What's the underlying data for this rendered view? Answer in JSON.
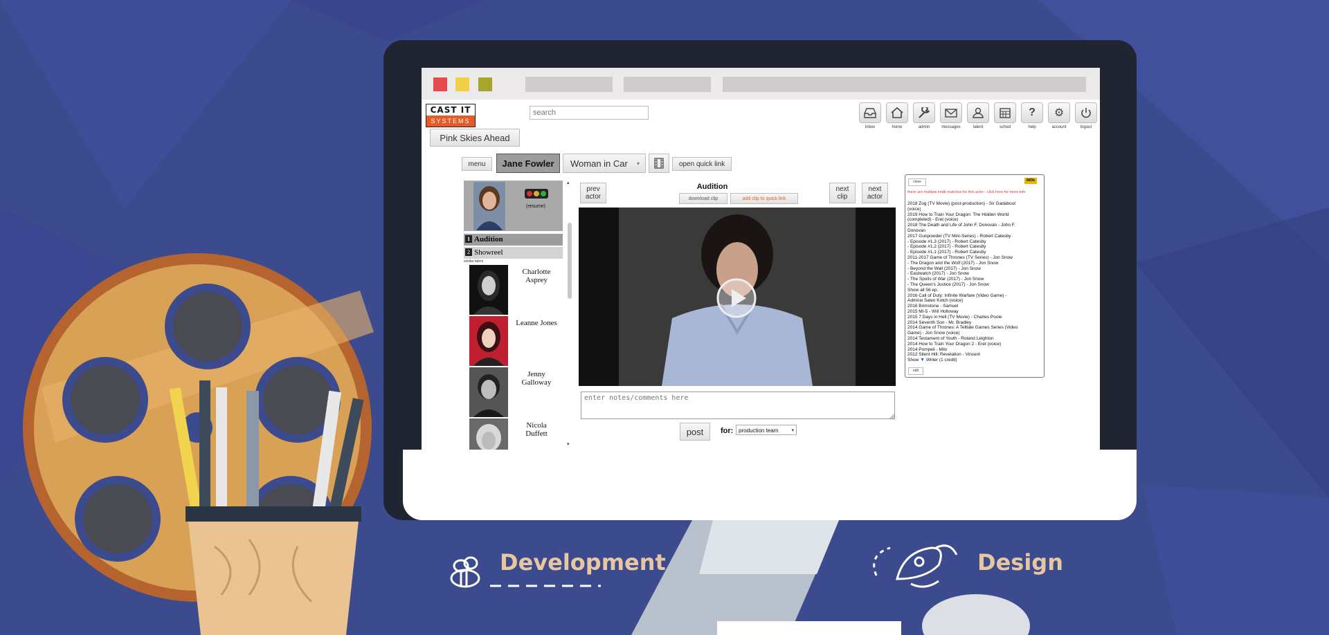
{
  "app": {
    "logo_top": "CAST IT",
    "logo_bottom": "SYSTEMS",
    "search_placeholder": "search",
    "toolbar": [
      {
        "icon": "inbox-icon",
        "label": "inbox"
      },
      {
        "icon": "home-icon",
        "label": "home"
      },
      {
        "icon": "wrench-icon",
        "label": "admin"
      },
      {
        "icon": "envelope-icon",
        "label": "messages"
      },
      {
        "icon": "user-icon",
        "label": "talent"
      },
      {
        "icon": "calendar-icon",
        "label": "sched"
      },
      {
        "icon": "help-icon",
        "label": "help"
      },
      {
        "icon": "gear-icon",
        "label": "account"
      },
      {
        "icon": "power-icon",
        "label": "logout"
      }
    ],
    "project_button": "Pink Skies Ahead",
    "menu_button": "menu",
    "actor_name": "Jane Fowler",
    "role_select": "Woman in Car",
    "open_quick_link": "open quick link",
    "current_actor": {
      "status": "(resume)"
    },
    "clips": [
      {
        "num": "1",
        "label": "Audition"
      },
      {
        "num": "2",
        "label": "Showreel"
      }
    ],
    "similar_label": "similar talent",
    "talent_list": [
      {
        "name": "Charlotte Asprey"
      },
      {
        "name": "Leanne Jones"
      },
      {
        "name": "Jenny Galloway"
      },
      {
        "name": "Nicola Duffett"
      }
    ],
    "video": {
      "title": "Audition",
      "prev_actor": "prev actor",
      "next_clip": "next clip",
      "next_actor": "next actor",
      "download_clip": "download clip",
      "add_clip": "add clip to quick link"
    },
    "notes_placeholder": "enter notes/comments here",
    "post_button": "post",
    "for_label": "for:",
    "for_select": "production team",
    "imdb": {
      "close": "close",
      "badge": "IMDb",
      "warning": "there are multiple imdb matches for this actor - click here for more info",
      "lines": [
        "2018 Zog (TV Movie) (post-production) - Sir Gadabout",
        "(voice)",
        "2019 How to Train Your Dragon: The Hidden World",
        "(completed) - Eret (voice)",
        "2018 The Death and Life of John F. Donovan - John F.",
        "Donovan",
        "2017 Gunpowder (TV Mini-Series) - Robert Catesby",
        "- Episode #1.3 (2017) - Robert Catesby",
        "- Episode #1.2 (2017) - Robert Catesby",
        "- Episode #1.1 (2017) - Robert Catesby",
        "2011-2017 Game of Thrones (TV Series) - Jon Snow",
        "- The Dragon and the Wolf (2017) - Jon Snow",
        "- Beyond the Wall (2017) - Jon Snow",
        "- Eastwatch (2017) - Jon Snow",
        "- The Spoils of War (2017) - Jon Snow",
        "- The Queen's Justice (2017) - Jon Snow",
        "Show all 56 ep.",
        "2016 Call of Duty: Infinite Warfare (Video Game) -",
        "Admiral Salen Kotch (voice)",
        "2016 Brimstone - Samuel",
        "2015 MI-5 - Will Holloway",
        "2015 7 Days in Hell (TV Movie) - Charles Poole",
        "2014 Seventh Son - Mr. Bradley",
        "2014 Game of Thrones: A Telltale Games Series (Video",
        "Game) - Jon Snow (voice)",
        "2014 Testament of Youth - Roland Leighton",
        "2014 How to Train Your Dragon 2 - Eret (voice)",
        "2014 Pompeii - Milo",
        "2012 Silent Hill: Revelation - Vincent"
      ],
      "show_label": "Show",
      "writer_label": "Writer (1 credit)",
      "edit": "edit"
    }
  },
  "captions": {
    "development": "Development",
    "design": "Design"
  },
  "colors": {
    "background": "#3c4a8e",
    "accent": "#e8c7a0",
    "logo_orange": "#e55a2a",
    "traffic_red": "#e64a4a",
    "traffic_yellow": "#f2cf4a",
    "traffic_olive": "#a7a62c"
  }
}
